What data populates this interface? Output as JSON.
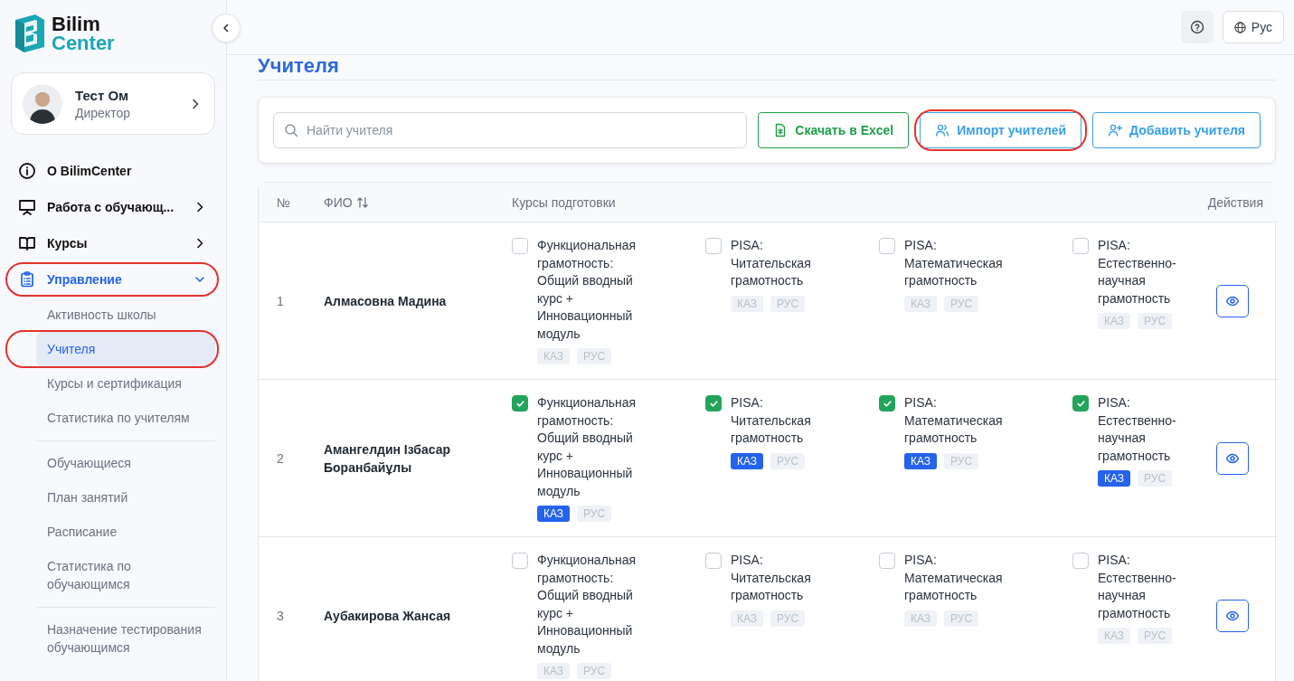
{
  "logo": {
    "line1": "Bilim",
    "line2": "Center"
  },
  "user": {
    "name": "Тест Ом",
    "role": "Директор"
  },
  "nav": [
    {
      "label": "О BilimCenter",
      "kind": "link",
      "expanded": false,
      "annotated": false
    },
    {
      "label": "Работа с обучающ...",
      "kind": "group",
      "expanded": false,
      "annotated": false
    },
    {
      "label": "Курсы",
      "kind": "group",
      "expanded": false,
      "annotated": false
    },
    {
      "label": "Управление",
      "kind": "group",
      "expanded": true,
      "annotated": true,
      "children": [
        {
          "label": "Активность школы",
          "selected": false,
          "divider_before": false,
          "annotated": false
        },
        {
          "label": "Учителя",
          "selected": true,
          "divider_before": false,
          "annotated": true
        },
        {
          "label": "Курсы и сертификация",
          "selected": false,
          "divider_before": false,
          "annotated": false
        },
        {
          "label": "Статистика по учителям",
          "selected": false,
          "divider_before": false,
          "annotated": false
        },
        {
          "label": "Обучающиеся",
          "selected": false,
          "divider_before": true,
          "annotated": false
        },
        {
          "label": "План занятий",
          "selected": false,
          "divider_before": false,
          "annotated": false
        },
        {
          "label": "Расписание",
          "selected": false,
          "divider_before": false,
          "annotated": false
        },
        {
          "label": "Статистика по обучающимся",
          "selected": false,
          "divider_before": false,
          "annotated": false
        },
        {
          "label": "Назначение тестирования обучающимся",
          "selected": false,
          "divider_before": true,
          "annotated": false
        }
      ]
    }
  ],
  "header": {
    "language": "Рус"
  },
  "page_title": "Учителя",
  "toolbar": {
    "search": {
      "placeholder": "Найти учителя"
    },
    "buttons": [
      {
        "label": "Скачать в Excel",
        "kind": "excel",
        "annotated": false
      },
      {
        "label": "Импорт учителей",
        "kind": "import",
        "annotated": true
      },
      {
        "label": "Добавить учителя",
        "kind": "add",
        "annotated": false
      }
    ]
  },
  "table": {
    "columns": [
      {
        "label": "№",
        "sortable": false
      },
      {
        "label": "ФИО",
        "sortable": true
      },
      {
        "label": "Курсы подготовки",
        "sortable": false
      },
      {
        "label": "Действия",
        "sortable": false
      }
    ],
    "rows": [
      {
        "number": "1",
        "name": "Алмасовна Мадина",
        "courses": [
          {
            "title": "Функциональная грамотность: Общий вводный курс + Инновационный модуль",
            "checked": false,
            "langs": [
              {
                "label": "КАЗ",
                "selected": false
              },
              {
                "label": "РУС",
                "selected": false
              }
            ]
          },
          {
            "title": "PISA: Читательская грамотность",
            "checked": false,
            "langs": [
              {
                "label": "КАЗ",
                "selected": false
              },
              {
                "label": "РУС",
                "selected": false
              }
            ]
          },
          {
            "title": "PISA: Математическая грамотность",
            "checked": false,
            "langs": [
              {
                "label": "КАЗ",
                "selected": false
              },
              {
                "label": "РУС",
                "selected": false
              }
            ]
          },
          {
            "title": "PISA: Естественно-научная грамотность",
            "checked": false,
            "langs": [
              {
                "label": "КАЗ",
                "selected": false
              },
              {
                "label": "РУС",
                "selected": false
              }
            ]
          }
        ]
      },
      {
        "number": "2",
        "name": "Амангелдин Ізбасар Боранбайұлы",
        "courses": [
          {
            "title": "Функциональная грамотность: Общий вводный курс + Инновационный модуль",
            "checked": true,
            "langs": [
              {
                "label": "КАЗ",
                "selected": true
              },
              {
                "label": "РУС",
                "selected": false
              }
            ]
          },
          {
            "title": "PISA: Читательская грамотность",
            "checked": true,
            "langs": [
              {
                "label": "КАЗ",
                "selected": true
              },
              {
                "label": "РУС",
                "selected": false
              }
            ]
          },
          {
            "title": "PISA: Математическая грамотность",
            "checked": true,
            "langs": [
              {
                "label": "КАЗ",
                "selected": true
              },
              {
                "label": "РУС",
                "selected": false
              }
            ]
          },
          {
            "title": "PISA: Естественно-научная грамотность",
            "checked": true,
            "langs": [
              {
                "label": "КАЗ",
                "selected": true
              },
              {
                "label": "РУС",
                "selected": false
              }
            ]
          }
        ]
      },
      {
        "number": "3",
        "name": "Аубакирова Жансая",
        "courses": [
          {
            "title": "Функциональная грамотность: Общий вводный курс + Инновационный модуль",
            "checked": false,
            "langs": [
              {
                "label": "КАЗ",
                "selected": false
              },
              {
                "label": "РУС",
                "selected": false
              }
            ]
          },
          {
            "title": "PISA: Читательская грамотность",
            "checked": false,
            "langs": [
              {
                "label": "КАЗ",
                "selected": false
              },
              {
                "label": "РУС",
                "selected": false
              }
            ]
          },
          {
            "title": "PISA: Математическая грамотность",
            "checked": false,
            "langs": [
              {
                "label": "КАЗ",
                "selected": false
              },
              {
                "label": "РУС",
                "selected": false
              }
            ]
          },
          {
            "title": "PISA: Естественно-научная грамотность",
            "checked": false,
            "langs": [
              {
                "label": "КАЗ",
                "selected": false
              },
              {
                "label": "РУС",
                "selected": false
              }
            ]
          }
        ]
      }
    ]
  }
}
